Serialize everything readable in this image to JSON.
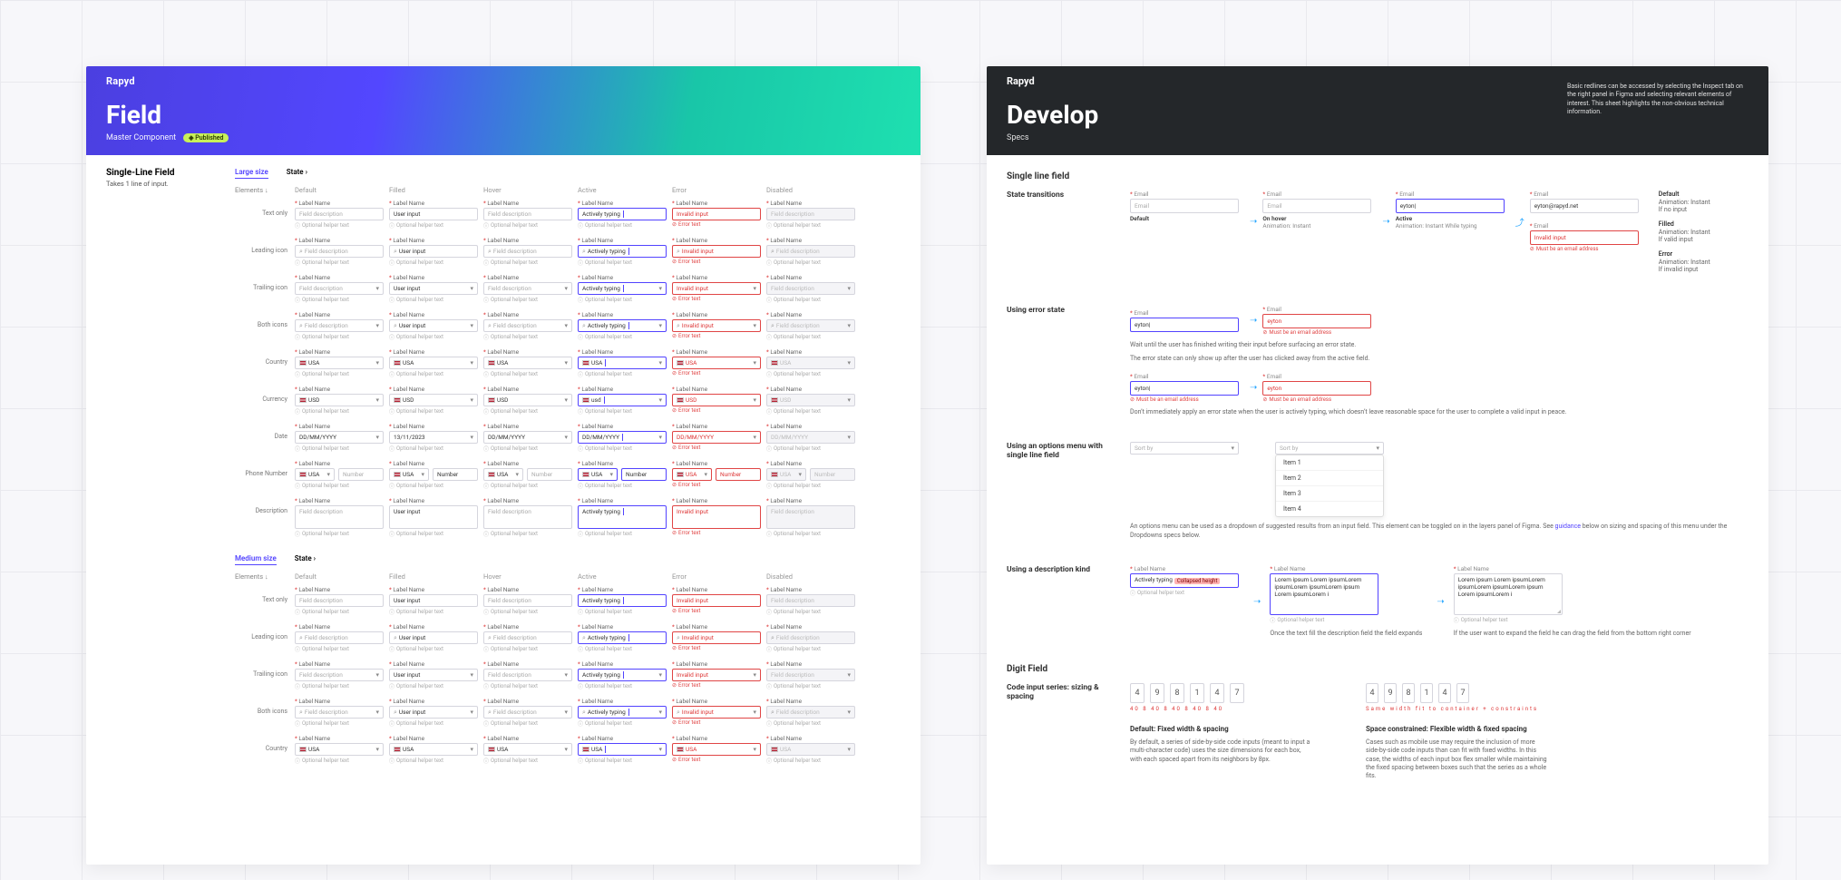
{
  "brand": "Rapyd",
  "left": {
    "title": "Field",
    "subtitle": "Master Component",
    "badge": "◈ Published",
    "side_heading": "Single-Line Field",
    "side_desc": "Takes 1 line of input.",
    "tabs": [
      "Large size",
      "State ›"
    ],
    "header_elements": "Elements ↓",
    "columns": [
      "Default",
      "Filled",
      "Hover",
      "Active",
      "Error",
      "Disabled"
    ],
    "row_labels": [
      "Text only",
      "Leading icon",
      "Trailing icon",
      "Both icons",
      "Country",
      "Currency",
      "Date",
      "Phone Number",
      "Description"
    ],
    "tabs2": [
      "Medium size",
      "State ›"
    ],
    "row_labels2": [
      "Text only",
      "Leading icon",
      "Trailing icon",
      "Both icons",
      "Country"
    ],
    "field_label": "Label Name",
    "placeholder": "Field description",
    "user_input": "User input",
    "typing": "Actively typing",
    "invalid": "Invalid input",
    "helper": "Optional helper text",
    "error_text": "Error text",
    "usa": "USA",
    "usd": "USD",
    "usd_lc": "usd",
    "date_placeholder": "DD/MM/YYYY",
    "date_filled": "13/11/2023",
    "phone_num": "Number"
  },
  "right": {
    "title": "Develop",
    "subtitle": "Specs",
    "header_note": "Basic redlines can be accessed by selecting the Inspect tab on the right panel in Figma and selecting relevant elements of interest. This sheet highlights the non-obvious technical information.",
    "sec1_h3": "Single line field",
    "sec1_h4": "State transitions",
    "states": {
      "default": {
        "name": "Default",
        "note": "Animation: Instant\nIf no input"
      },
      "hover": {
        "name": "On hover",
        "note": "Animation: Instant"
      },
      "active": {
        "name": "Active",
        "note": "Animation: Instant\nWhile typing"
      },
      "filled": {
        "name": "Filled",
        "note": "Animation: Instant\nIf valid input"
      },
      "error": {
        "name": "Error",
        "note": "Animation: Instant\nIf invalid input"
      }
    },
    "email_label": "Email",
    "email_placeholder": "Email",
    "email_typing": "eyton|",
    "email_filled": "eyton@rapyd.net",
    "email_invalid": "Invalid input",
    "must_be_email": "Must be an email address",
    "sec2_h4": "Using error state",
    "sec2_note1": "Wait until the user has finished writing their input before surfacing an error state.",
    "sec2_note2": "The error state can only show up after the user has clicked away from the active field.",
    "sec2_note3": "Don’t immediately apply an error state when the user is actively typing, which doesn’t leave reasonable space for the user to complete a valid input in peace.",
    "sec3_h4_a": "Using an options menu with single line field",
    "sortby": "Sort by",
    "menu_items": [
      "Item 1",
      "Item 2",
      "Item 3",
      "Item 4"
    ],
    "sec3_note": "An options menu can be used as a dropdown of suggested results from an input field. This element can be toggled on in the layers panel of Figma. See guidance below on sizing and spacing of this menu under the Dropdowns specs below.",
    "sec4_h4": "Using a description kind",
    "desc_typing": "Actively typing",
    "desc_mark": "Collapsed height",
    "lorem": "Lorem ipsum Lorem ipsumLorem ipsumLorem ipsumLorem ipsum Lorem ipsumLorem i",
    "sec4_note1": "Once the text fill the description field the field expands",
    "sec4_note2": "If the user want to expand the field he can drag the field from the bottom right corner",
    "digit_h3": "Digit Field",
    "digit_h4": "Code input series: sizing & spacing",
    "digits_a": [
      "4",
      "9",
      "8",
      "1",
      "4",
      "7"
    ],
    "digits_b": [
      "4",
      "9",
      "8",
      "1",
      "4",
      "7"
    ],
    "redspec_a": "40    8    40    8    40    8    40    8    40",
    "redspec_b": "Same width fit to container + constraints",
    "digit_head_a": "Default: Fixed width & spacing",
    "digit_note_a": "By default, a series of side-by-side code inputs (meant to input a multi-character code) uses the size dimensions for each box, with each spaced apart from its neighbors by 8px.",
    "digit_head_b": "Space constrained: Flexible width & fixed spacing",
    "digit_note_b": "Cases such as mobile use may require the inclusion of more side-by-side code inputs than can fit with fixed widths. In this case, the widths of each input box flex smaller while maintaining the fixed spacing between boxes such that the series as a whole fits."
  }
}
